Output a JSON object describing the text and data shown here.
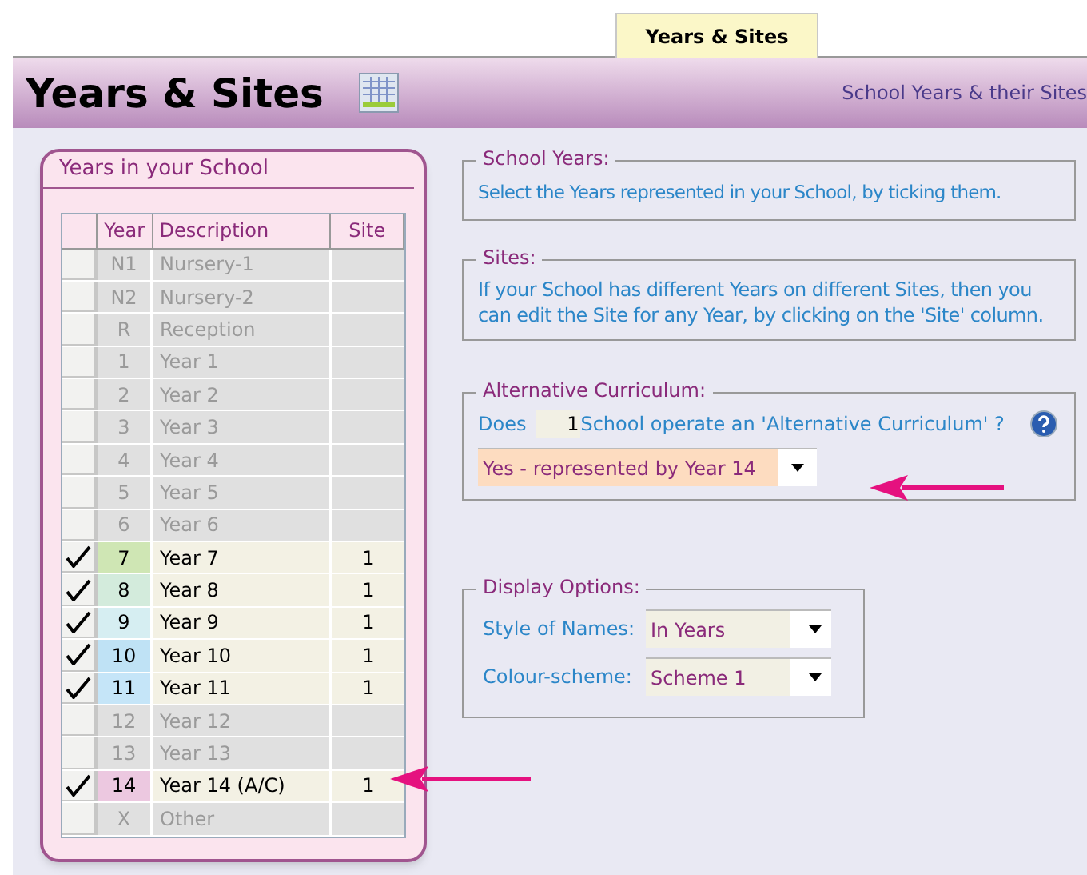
{
  "tab": {
    "label": "Years & Sites",
    "selected": true
  },
  "header": {
    "title": "Years & Sites",
    "subtitle": "School Years & their Sites"
  },
  "years_panel": {
    "title": "Years in your School",
    "columns": [
      "Year",
      "Description",
      "Site"
    ],
    "rows": [
      {
        "year": "N1",
        "description": "Nursery-1",
        "checked": false
      },
      {
        "year": "N2",
        "description": "Nursery-2",
        "checked": false
      },
      {
        "year": "R",
        "description": "Reception",
        "checked": false
      },
      {
        "year": "1",
        "description": "Year 1",
        "checked": false
      },
      {
        "year": "2",
        "description": "Year 2",
        "checked": false
      },
      {
        "year": "3",
        "description": "Year 3",
        "checked": false
      },
      {
        "year": "4",
        "description": "Year 4",
        "checked": false
      },
      {
        "year": "5",
        "description": "Year 5",
        "checked": false
      },
      {
        "year": "6",
        "description": "Year 6",
        "checked": false
      },
      {
        "year": "7",
        "description": "Year 7",
        "site": "1",
        "checked": true,
        "color": "#cfe6b4"
      },
      {
        "year": "8",
        "description": "Year 8",
        "site": "1",
        "checked": true,
        "color": "#d3ebdc"
      },
      {
        "year": "9",
        "description": "Year 9",
        "site": "1",
        "checked": true,
        "color": "#d6eef2"
      },
      {
        "year": "10",
        "description": "Year 10",
        "site": "1",
        "checked": true,
        "color": "#bfe2f5"
      },
      {
        "year": "11",
        "description": "Year 11",
        "site": "1",
        "checked": true,
        "color": "#c5e5f8"
      },
      {
        "year": "12",
        "description": "Year 12",
        "checked": false
      },
      {
        "year": "13",
        "description": "Year 13",
        "checked": false
      },
      {
        "year": "14",
        "description": "Year 14 (A/C)",
        "site": "1",
        "checked": true,
        "color": "#ecc8e0"
      },
      {
        "year": "X",
        "description": "Other",
        "checked": false
      }
    ]
  },
  "school_years": {
    "legend": "School Years:",
    "text": "Select the Years represented in your School, by ticking them."
  },
  "sites": {
    "legend": "Sites:",
    "text": "If your School has different Years on different Sites, then you can edit the Site for any Year, by clicking on the 'Site' column."
  },
  "alternative_curriculum": {
    "legend": "Alternative Curriculum:",
    "question_start": "Does",
    "field_value": "1",
    "question_end": "School operate an 'Alternative Curriculum' ?",
    "dropdown": "Yes - represented by Year 14"
  },
  "display_options": {
    "legend": "Display Options:",
    "fields": [
      {
        "label": "Style of Names:",
        "value": "In Years"
      },
      {
        "label": "Colour-scheme:",
        "value": "Scheme 1"
      }
    ]
  }
}
